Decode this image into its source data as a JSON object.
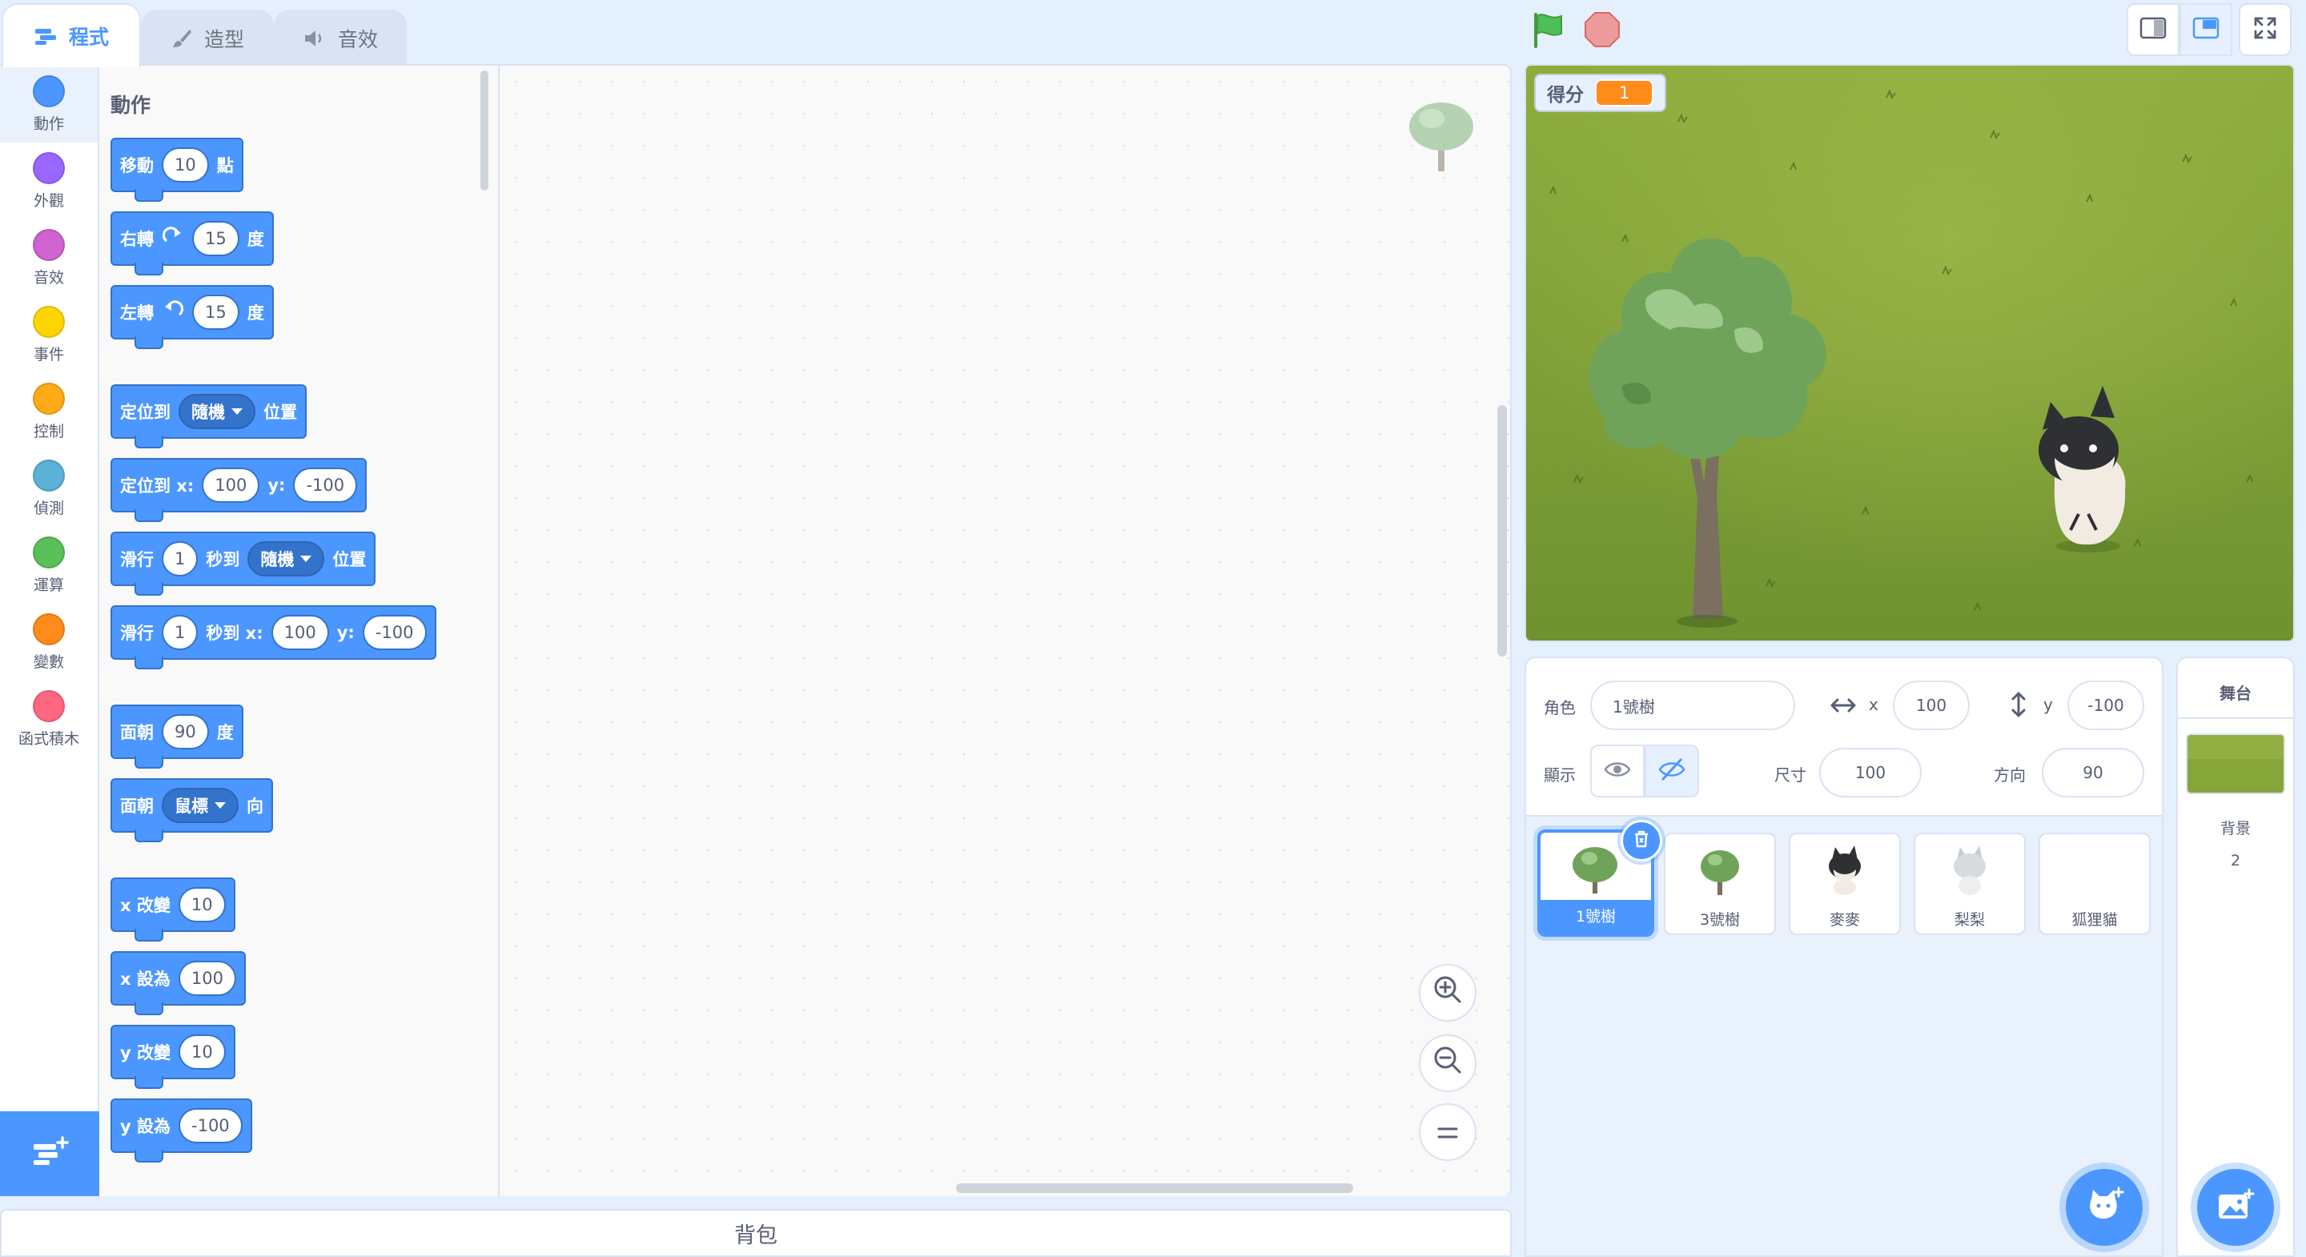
{
  "tabs": [
    {
      "label": "程式",
      "icon": "code-icon",
      "active": true
    },
    {
      "label": "造型",
      "icon": "brush-icon",
      "active": false
    },
    {
      "label": "音效",
      "icon": "speaker-icon",
      "active": false
    }
  ],
  "categories": [
    {
      "label": "動作",
      "color": "#4c97ff"
    },
    {
      "label": "外觀",
      "color": "#9966ff"
    },
    {
      "label": "音效",
      "color": "#cf63cf"
    },
    {
      "label": "事件",
      "color": "#ffd500"
    },
    {
      "label": "控制",
      "color": "#ffab19"
    },
    {
      "label": "偵測",
      "color": "#5cb1d6"
    },
    {
      "label": "運算",
      "color": "#59c059"
    },
    {
      "label": "變數",
      "color": "#ff8c1a"
    },
    {
      "label": "函式積木",
      "color": "#ff6680"
    }
  ],
  "palette": {
    "section_title": "動作",
    "blocks": {
      "move": {
        "a": "移動",
        "v": "10",
        "b": "點"
      },
      "turn_right": {
        "a": "右轉",
        "v": "15",
        "b": "度"
      },
      "turn_left": {
        "a": "左轉",
        "v": "15",
        "b": "度"
      },
      "goto_menu": {
        "a": "定位到",
        "menu": "隨機",
        "b": "位置"
      },
      "goto_xy": {
        "a": "定位到 x:",
        "x": "100",
        "ylbl": "y:",
        "y": "-100"
      },
      "glide_menu": {
        "a": "滑行",
        "v": "1",
        "b": "秒到",
        "menu": "隨機",
        "c": "位置"
      },
      "glide_xy": {
        "a": "滑行",
        "v": "1",
        "b": "秒到 x:",
        "x": "100",
        "ylbl": "y:",
        "y": "-100"
      },
      "point_dir": {
        "a": "面朝",
        "v": "90",
        "b": "度"
      },
      "point_towards": {
        "a": "面朝",
        "menu": "鼠標",
        "b": "向"
      },
      "change_x": {
        "a": "x 改變",
        "v": "10"
      },
      "set_x": {
        "a": "x 設為",
        "v": "100"
      },
      "change_y": {
        "a": "y 改變",
        "v": "10"
      },
      "set_y": {
        "a": "y 設為",
        "v": "-100"
      }
    }
  },
  "backpack": {
    "label": "背包"
  },
  "monitor": {
    "label": "得分",
    "value": "1"
  },
  "sprite_info": {
    "sprite_label": "角色",
    "sprite_name": "1號樹",
    "x_label": "x",
    "x_value": "100",
    "y_label": "y",
    "y_value": "-100",
    "show_label": "顯示",
    "size_label": "尺寸",
    "size_value": "100",
    "direction_label": "方向",
    "direction_value": "90"
  },
  "sprites": [
    {
      "name": "1號樹",
      "selected": true
    },
    {
      "name": "3號樹",
      "selected": false
    },
    {
      "name": "麥麥",
      "selected": false
    },
    {
      "name": "梨梨",
      "selected": false
    },
    {
      "name": "狐狸貓",
      "selected": false
    }
  ],
  "stage_pane": {
    "title": "舞台",
    "backdrop_label": "背景",
    "backdrop_count": "2"
  },
  "colors": {
    "accent": "#4c97ff",
    "motion": "#4c97ff",
    "motion_dark": "#3373cc",
    "panel_bg": "#e5f0ff"
  }
}
